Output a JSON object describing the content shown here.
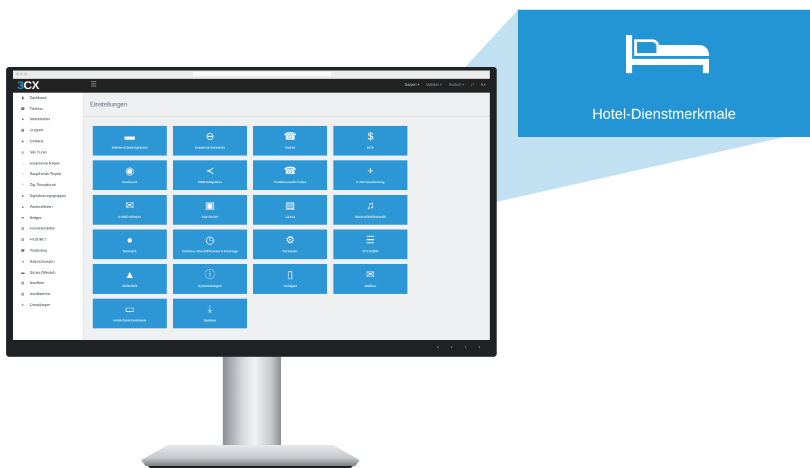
{
  "callout": {
    "icon": "bed-icon",
    "label": "Hotel-Dienstmerkmale",
    "color": "#2395d4"
  },
  "app": {
    "logo_prefix": "3",
    "logo_suffix": "CX",
    "menu_icon": "hamburger-icon"
  },
  "topnav": [
    {
      "label": "Support ▾"
    },
    {
      "label": "Updates ▾"
    },
    {
      "label": "Deutsch ▾"
    },
    {
      "label": "⤢"
    },
    {
      "label": "A ▾"
    }
  ],
  "sidebar": {
    "items": [
      {
        "label": "Dashboard",
        "icon": "bar-chart-icon",
        "glyph": "▮"
      },
      {
        "label": "Telefone",
        "icon": "phone-icon",
        "glyph": "☎"
      },
      {
        "label": "Nebenstellen",
        "icon": "user-icon",
        "glyph": "●"
      },
      {
        "label": "Gruppen",
        "icon": "grid-icon",
        "glyph": "▦"
      },
      {
        "label": "Kontakte",
        "icon": "contact-icon",
        "glyph": "●"
      },
      {
        "label": "SIP-Trunks",
        "icon": "globe-icon",
        "glyph": "◎"
      },
      {
        "label": "Eingehende Regeln",
        "icon": "arrow-down-icon",
        "glyph": "↓"
      },
      {
        "label": "Ausgehende Regeln",
        "icon": "arrow-up-icon",
        "glyph": "↑"
      },
      {
        "label": "Dig. Rezeptionist",
        "icon": "headset-icon",
        "glyph": "◠"
      },
      {
        "label": "Signalisierungsgruppen",
        "icon": "users-icon",
        "glyph": "●"
      },
      {
        "label": "Warteschleifen",
        "icon": "queue-icon",
        "glyph": "●"
      },
      {
        "label": "Bridges",
        "icon": "exchange-icon",
        "glyph": "⇄"
      },
      {
        "label": "Faxnebenstellen",
        "icon": "fax-icon",
        "glyph": "▤"
      },
      {
        "label": "FXS/DECT",
        "icon": "device-icon",
        "glyph": "▤"
      },
      {
        "label": "Hotdesking",
        "icon": "desk-phone-icon",
        "glyph": "☎"
      },
      {
        "label": "Aufzeichnungen",
        "icon": "volume-icon",
        "glyph": "◂"
      },
      {
        "label": "Sichern/Wiederh.",
        "icon": "folder-icon",
        "glyph": "▬"
      },
      {
        "label": "Anrufliste",
        "icon": "list-icon",
        "glyph": "▤"
      },
      {
        "label": "Anrufberichte",
        "icon": "report-icon",
        "glyph": "▤"
      },
      {
        "label": "Einstellungen",
        "icon": "wrench-icon",
        "glyph": "✎"
      }
    ]
  },
  "page": {
    "title": "Einstellungen"
  },
  "tiles": [
    {
      "label": "Telefon-/Client-Optionen",
      "icon": "phone-device-icon",
      "glyph": "▬"
    },
    {
      "label": "Gesperrte Nummern",
      "icon": "block-icon",
      "glyph": "⊖"
    },
    {
      "label": "Parken",
      "icon": "phone-icon",
      "glyph": "☎"
    },
    {
      "label": "KDS",
      "icon": "dollar-icon",
      "glyph": "$"
    },
    {
      "label": "Konferenz",
      "icon": "eye-icon",
      "glyph": "◉"
    },
    {
      "label": "CRM-Integration",
      "icon": "share-icon",
      "glyph": "≺"
    },
    {
      "label": "Funktionswahl-Codes",
      "icon": "phone-icon",
      "glyph": "☎"
    },
    {
      "label": "E.164 Verarbeitung",
      "icon": "plus-icon",
      "glyph": "+"
    },
    {
      "label": "E-Mail-Adresse",
      "icon": "envelope-icon",
      "glyph": "✉"
    },
    {
      "label": "Fax-Server",
      "icon": "fax-icon",
      "glyph": "▣"
    },
    {
      "label": "Lizenz",
      "icon": "license-icon",
      "glyph": "▤"
    },
    {
      "label": "Warteschleifenmusik",
      "icon": "music-icon",
      "glyph": "♫"
    },
    {
      "label": "Netzwerk",
      "icon": "globe-icon",
      "glyph": "●"
    },
    {
      "label": "Zeitzone, Geschäftszeiten & Feiertage",
      "icon": "clock-icon",
      "glyph": "◷"
    },
    {
      "label": "Parameter",
      "icon": "gear-icon",
      "glyph": "⚙"
    },
    {
      "label": "3CX-FQDN",
      "icon": "server-icon",
      "glyph": "☰"
    },
    {
      "label": "Sicherheit",
      "icon": "lock-icon",
      "glyph": "▲"
    },
    {
      "label": "Systemansagen",
      "icon": "info-icon",
      "glyph": "ⓘ"
    },
    {
      "label": "Vorlagen",
      "icon": "file-code-icon",
      "glyph": "▯"
    },
    {
      "label": "Mailbox",
      "icon": "envelope-icon",
      "glyph": "✉"
    },
    {
      "label": "Hotel-Dienstmerkmale",
      "icon": "bed-icon",
      "glyph": "▭"
    },
    {
      "label": "Updates",
      "icon": "download-icon",
      "glyph": "⤓"
    }
  ]
}
